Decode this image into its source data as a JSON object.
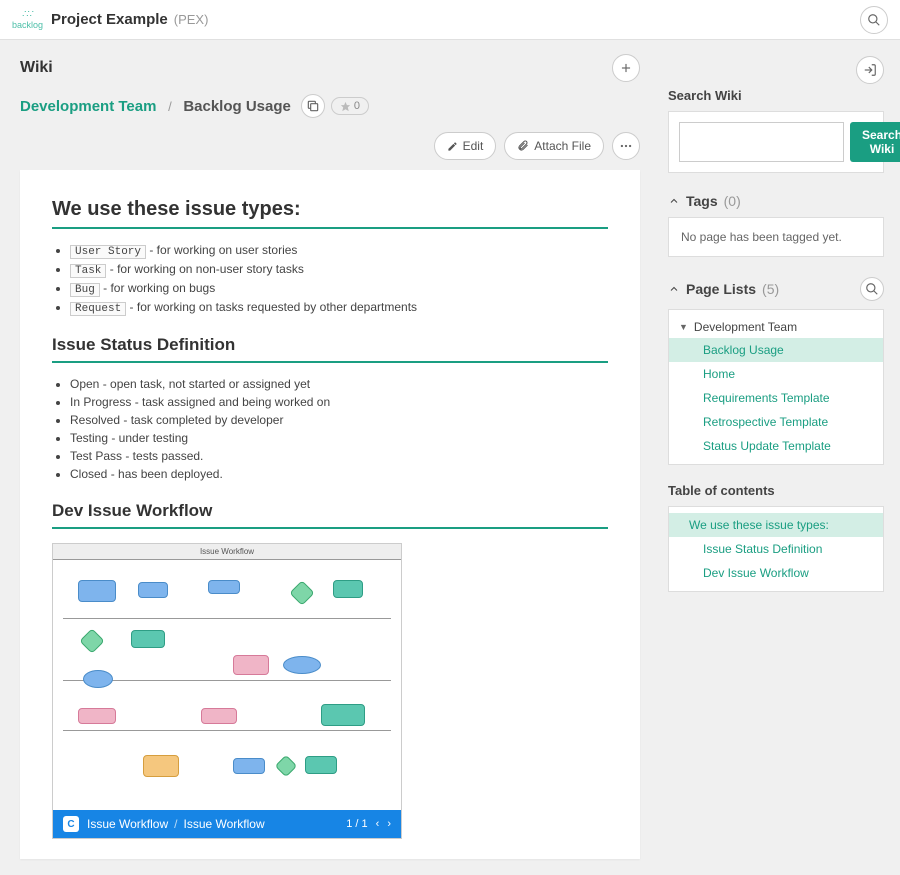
{
  "topbar": {
    "logo_text": "backlog",
    "project_name": "Project Example",
    "project_code": "(PEX)"
  },
  "wiki": {
    "title": "Wiki",
    "breadcrumb_parent": "Development Team",
    "breadcrumb_current": "Backlog Usage",
    "star_count": "0",
    "edit_label": "Edit",
    "attach_label": "Attach File"
  },
  "content": {
    "h1": "We use these issue types:",
    "issue_types": [
      {
        "tag": "User Story",
        "desc": " - for working on user stories"
      },
      {
        "tag": "Task",
        "desc": " - for working on non-user story tasks"
      },
      {
        "tag": "Bug",
        "desc": " - for working on bugs"
      },
      {
        "tag": "Request",
        "desc": " - for working on tasks requested by other departments"
      }
    ],
    "h2_status": "Issue Status Definition",
    "statuses": [
      "Open - open task, not started or assigned yet",
      "In Progress - task assigned and being worked on",
      "Resolved - task completed by developer",
      "Testing - under testing",
      "Test Pass - tests passed.",
      "Closed - has been deployed."
    ],
    "h2_workflow": "Dev Issue Workflow",
    "workflow_diagram_title": "Issue Workflow",
    "workflow_footer_a": "Issue Workflow",
    "workflow_footer_b": "Issue Workflow",
    "workflow_page": "1 / 1"
  },
  "sidebar": {
    "search_title": "Search Wiki",
    "search_button": "Search Wiki",
    "tags_title": "Tags",
    "tags_count": "(0)",
    "tags_empty": "No page has been tagged yet.",
    "pagelists_title": "Page Lists",
    "pagelists_count": "(5)",
    "pagelists_root": "Development Team",
    "pagelists_items": [
      "Backlog Usage",
      "Home",
      "Requirements Template",
      "Retrospective Template",
      "Status Update Template"
    ],
    "toc_title": "Table of contents",
    "toc_items": [
      "We use these issue types:",
      "Issue Status Definition",
      "Dev Issue Workflow"
    ]
  }
}
